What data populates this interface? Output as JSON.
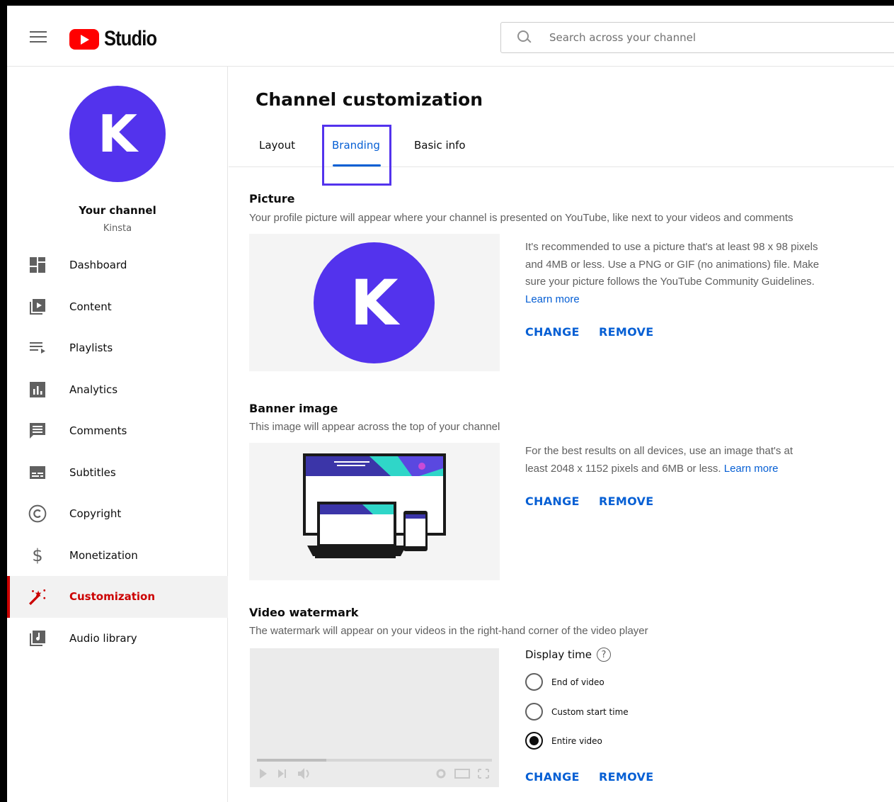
{
  "header": {
    "logo_text": "Studio",
    "search_placeholder": "Search across your channel"
  },
  "sidebar": {
    "avatar_letter": "K",
    "channel_title": "Your channel",
    "channel_name": "Kinsta",
    "items": [
      {
        "label": "Dashboard",
        "icon": "dashboard-icon"
      },
      {
        "label": "Content",
        "icon": "content-icon"
      },
      {
        "label": "Playlists",
        "icon": "playlists-icon"
      },
      {
        "label": "Analytics",
        "icon": "analytics-icon"
      },
      {
        "label": "Comments",
        "icon": "comments-icon"
      },
      {
        "label": "Subtitles",
        "icon": "subtitles-icon"
      },
      {
        "label": "Copyright",
        "icon": "copyright-icon"
      },
      {
        "label": "Monetization",
        "icon": "dollar-icon"
      },
      {
        "label": "Customization",
        "icon": "magic-wand-icon",
        "active": true
      },
      {
        "label": "Audio library",
        "icon": "audio-library-icon"
      }
    ]
  },
  "main": {
    "title": "Channel customization",
    "tabs": [
      "Layout",
      "Branding",
      "Basic info"
    ],
    "active_tab": "Branding",
    "picture": {
      "title": "Picture",
      "description": "Your profile picture will appear where your channel is presented on YouTube, like next to your videos and comments",
      "avatar_letter": "K",
      "info": "It's recommended to use a picture that's at least 98 x 98 pixels and 4MB or less. Use a PNG or GIF (no animations) file. Make sure your picture follows the YouTube Community Guidelines.",
      "learn_more": "Learn more",
      "change": "CHANGE",
      "remove": "REMOVE"
    },
    "banner": {
      "title": "Banner image",
      "description": "This image will appear across the top of your channel",
      "info": "For the best results on all devices, use an image that's at least 2048 x 1152 pixels and 6MB or less.",
      "learn_more": "Learn more",
      "change": "CHANGE",
      "remove": "REMOVE"
    },
    "watermark": {
      "title": "Video watermark",
      "description": "The watermark will appear on your videos in the right-hand corner of the video player",
      "display_time_label": "Display time",
      "options": [
        "End of video",
        "Custom start time",
        "Entire video"
      ],
      "selected": "Entire video",
      "change": "CHANGE",
      "remove": "REMOVE"
    }
  },
  "colors": {
    "brand_purple": "#5333ed",
    "link_blue": "#065fd4",
    "active_red": "#cc0000",
    "youtube_red": "#ff0000"
  }
}
